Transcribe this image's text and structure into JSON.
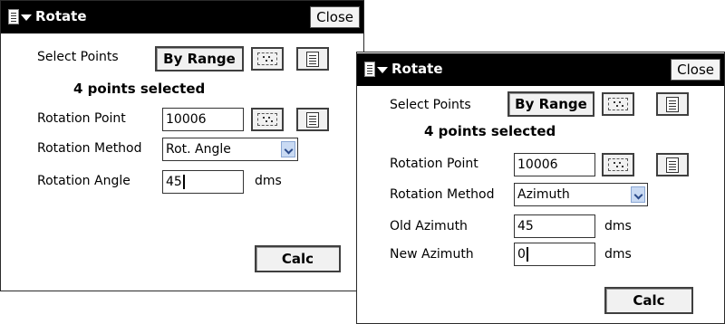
{
  "window_left": {
    "title": "Rotate",
    "close_label": "Close",
    "select_points_label": "Select Points",
    "by_range_label": "By Range",
    "points_selected": "4 points selected",
    "rotation_point_label": "Rotation Point",
    "rotation_point_value": "10006",
    "rotation_method_label": "Rotation Method",
    "rotation_method_value": "Rot. Angle",
    "rotation_angle_label": "Rotation Angle",
    "rotation_angle_value": "45",
    "rotation_angle_unit": "dms",
    "calc_label": "Calc"
  },
  "window_right": {
    "title": "Rotate",
    "close_label": "Close",
    "select_points_label": "Select Points",
    "by_range_label": "By Range",
    "points_selected": "4 points selected",
    "rotation_point_label": "Rotation Point",
    "rotation_point_value": "10006",
    "rotation_method_label": "Rotation Method",
    "rotation_method_value": "Azimuth",
    "old_azimuth_label": "Old Azimuth",
    "old_azimuth_value": "45",
    "old_azimuth_unit": "dms",
    "new_azimuth_label": "New Azimuth",
    "new_azimuth_value": "0",
    "new_azimuth_unit": "dms",
    "calc_label": "Calc"
  },
  "icons": {
    "menu": "menu-icon",
    "map_select": "map-select-icon",
    "list_select": "list-select-icon",
    "dropdown": "chevron-down-icon"
  },
  "colors": {
    "titlebar": "#000000",
    "background": "#ffffff",
    "dropdown_arrow": "#c9daf3"
  }
}
